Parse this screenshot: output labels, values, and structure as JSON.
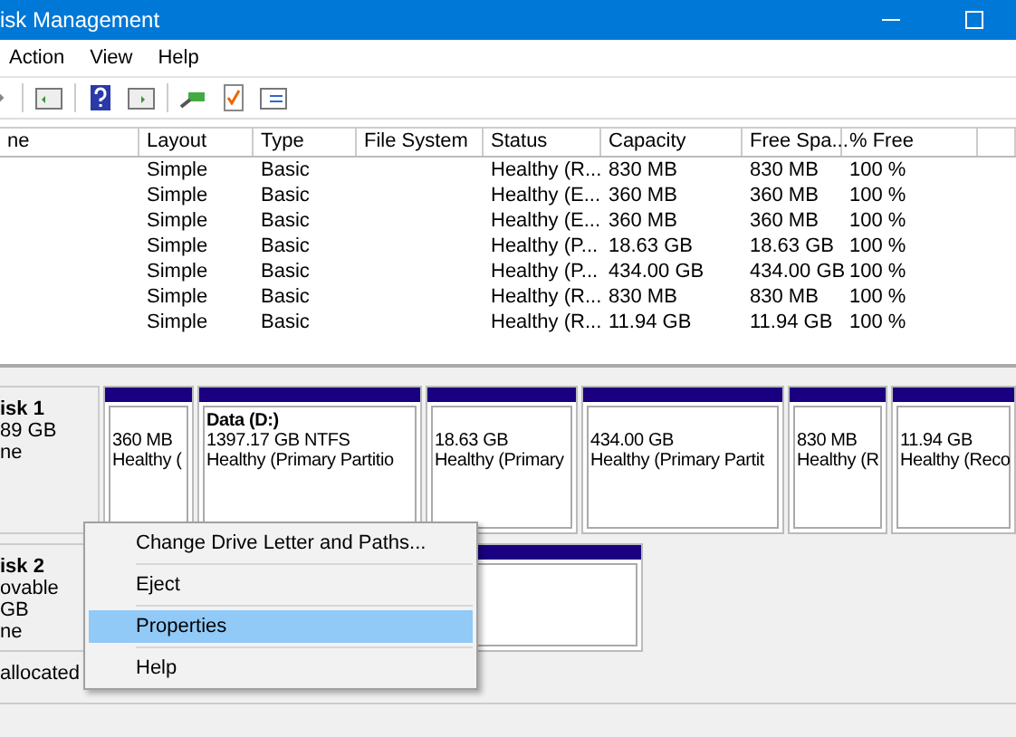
{
  "window": {
    "title": "isk Management"
  },
  "menu": [
    "Action",
    "View",
    "Help"
  ],
  "table": {
    "columns": [
      "ne",
      "Layout",
      "Type",
      "File System",
      "Status",
      "Capacity",
      "Free Spa...",
      "% Free"
    ],
    "rows": [
      [
        "",
        "Simple",
        "Basic",
        "",
        "Healthy (R...",
        "830 MB",
        "830 MB",
        "100 %"
      ],
      [
        "",
        "Simple",
        "Basic",
        "",
        "Healthy (E...",
        "360 MB",
        "360 MB",
        "100 %"
      ],
      [
        "",
        "Simple",
        "Basic",
        "",
        "Healthy (E...",
        "360 MB",
        "360 MB",
        "100 %"
      ],
      [
        "",
        "Simple",
        "Basic",
        "",
        "Healthy (P...",
        "18.63 GB",
        "18.63 GB",
        "100 %"
      ],
      [
        "",
        "Simple",
        "Basic",
        "",
        "Healthy (P...",
        "434.00 GB",
        "434.00 GB",
        "100 %"
      ],
      [
        "",
        "Simple",
        "Basic",
        "",
        "Healthy (R...",
        "830 MB",
        "830 MB",
        "100 %"
      ],
      [
        "",
        "Simple",
        "Basic",
        "",
        "Healthy (R...",
        "11.94 GB",
        "11.94 GB",
        "100 %"
      ]
    ]
  },
  "disks": [
    {
      "label": "isk 1",
      "lines": [
        "89 GB",
        "ne"
      ],
      "partitions": [
        {
          "size": "360 MB",
          "status": "Healthy ("
        },
        {
          "name": "Data  (D:)",
          "size": "1397.17 GB NTFS",
          "status": "Healthy (Primary Partitio"
        },
        {
          "size": "18.63 GB",
          "status": "Healthy (Primary"
        },
        {
          "size": "434.00 GB",
          "status": "Healthy (Primary Partit"
        },
        {
          "size": "830 MB",
          "status": "Healthy (R"
        },
        {
          "size": "11.94 GB",
          "status": "Healthy (Reco"
        }
      ]
    },
    {
      "label": "isk 2",
      "lines": [
        "ovable",
        "GB",
        "ne"
      ]
    }
  ],
  "legend": [
    "allocated"
  ],
  "context_menu": [
    {
      "label": "Change Drive Letter and Paths...",
      "selected": false
    },
    {
      "label": "Eject",
      "selected": false
    },
    {
      "label": "Properties",
      "selected": true
    },
    {
      "label": "Help",
      "selected": false
    }
  ]
}
